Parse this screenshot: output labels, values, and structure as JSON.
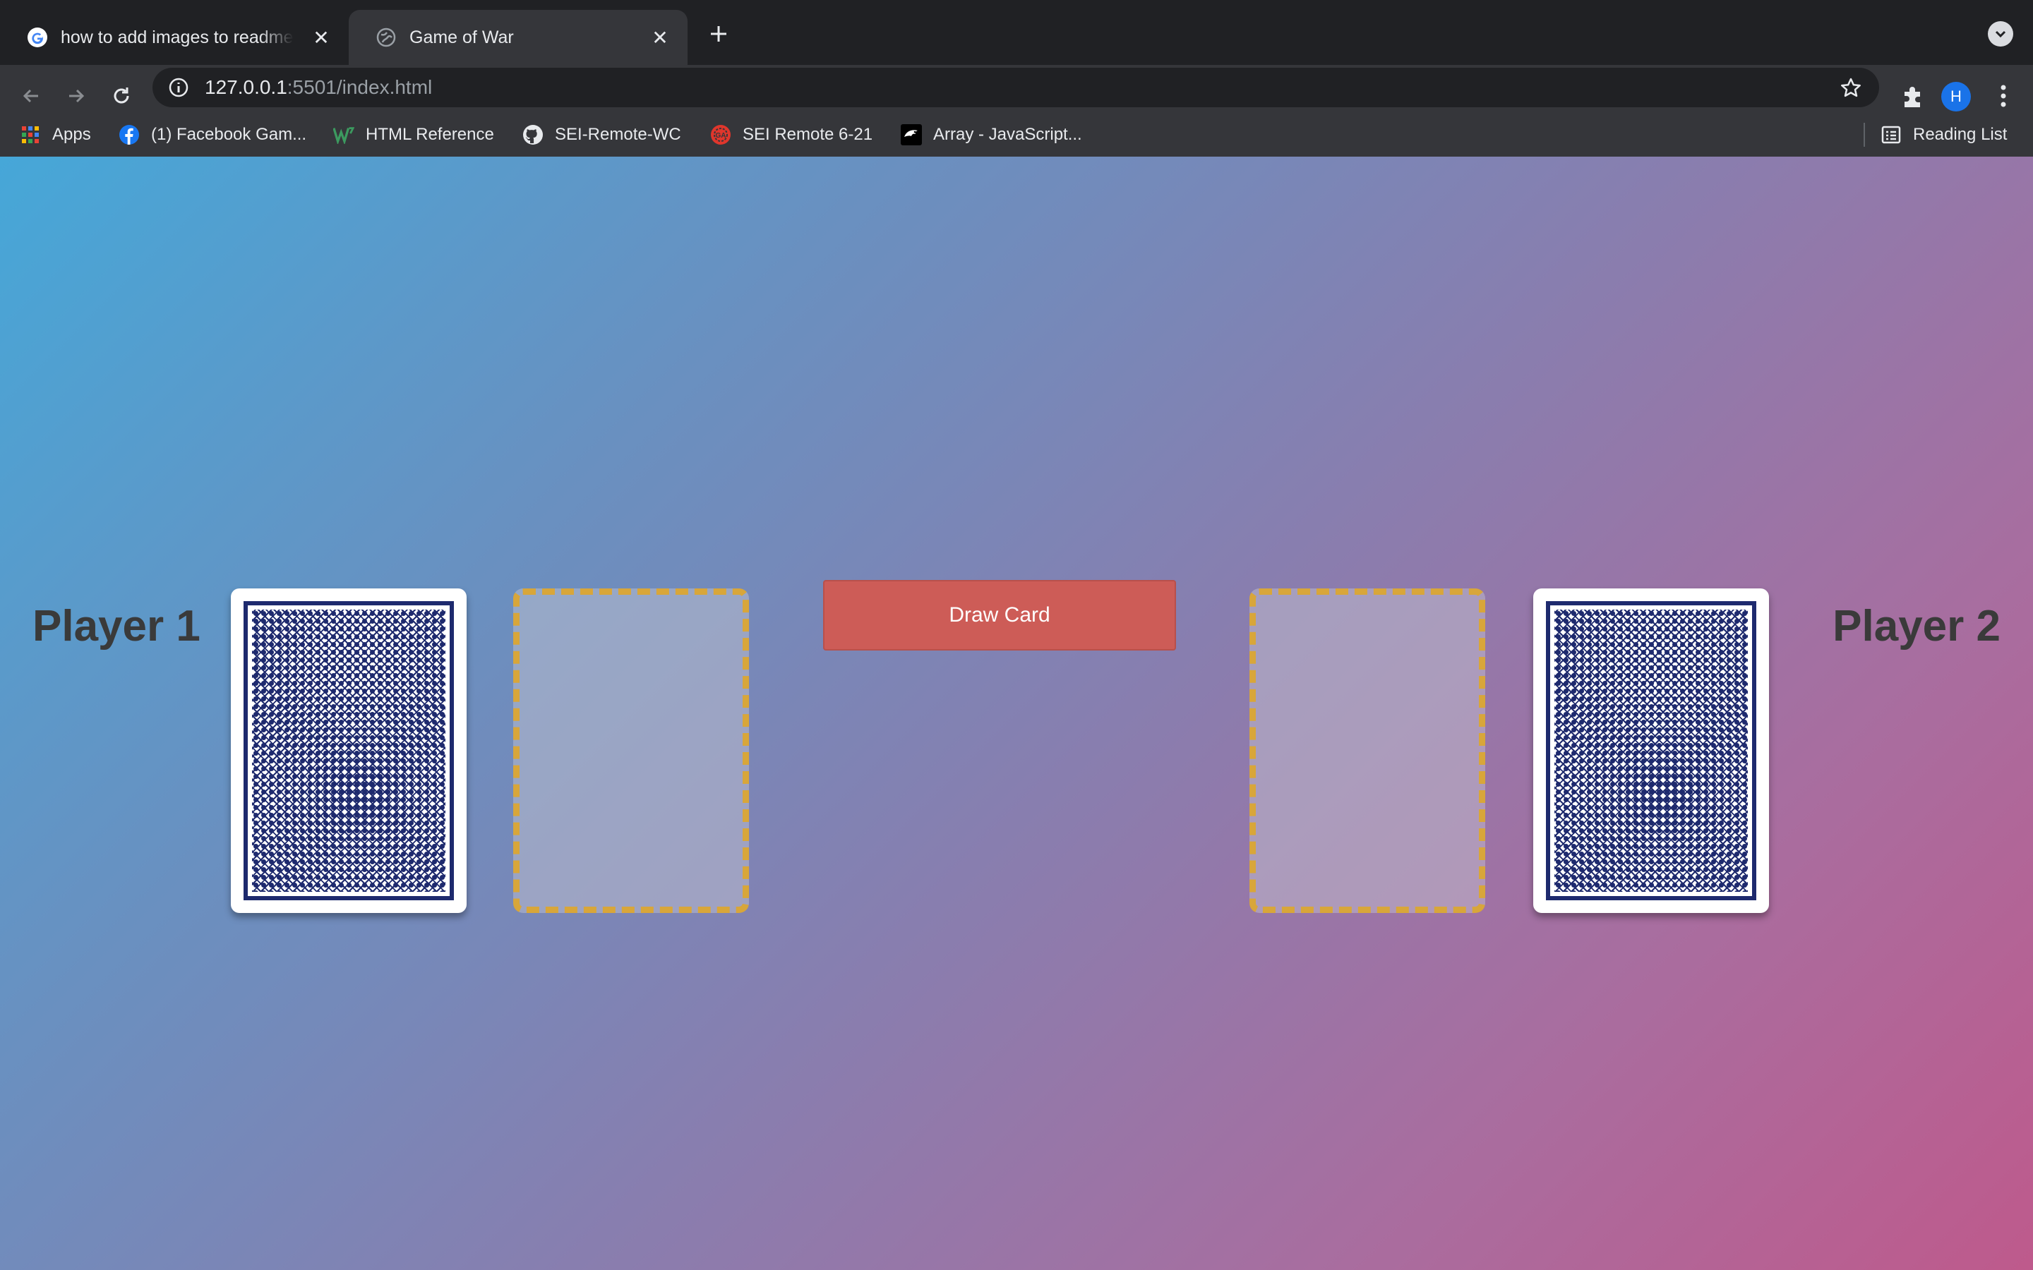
{
  "browser": {
    "tabs": [
      {
        "title": "how to add images to readme f",
        "favicon": "google-icon",
        "active": false
      },
      {
        "title": "Game of War",
        "favicon": "globe-icon",
        "active": true
      }
    ],
    "url": {
      "host": "127.0.0.1",
      "path": ":5501/index.html"
    },
    "profile_initial": "H",
    "bookmarks": [
      {
        "label": "Apps",
        "icon": "apps-grid-icon"
      },
      {
        "label": "(1) Facebook Gam...",
        "icon": "facebook-icon"
      },
      {
        "label": "HTML Reference",
        "icon": "w3-icon"
      },
      {
        "label": "SEI-Remote-WC",
        "icon": "github-icon"
      },
      {
        "label": "SEI Remote 6-21",
        "icon": "ga-icon"
      },
      {
        "label": "Array - JavaScript...",
        "icon": "mdn-icon"
      }
    ],
    "reading_list": "Reading List"
  },
  "game": {
    "player1_label": "Player 1",
    "player2_label": "Player 2",
    "draw_button": "Draw Card",
    "colors": {
      "card_back": "#1e2a6e",
      "slot_border": "#d8a63a",
      "button": "#cd5c57"
    }
  }
}
